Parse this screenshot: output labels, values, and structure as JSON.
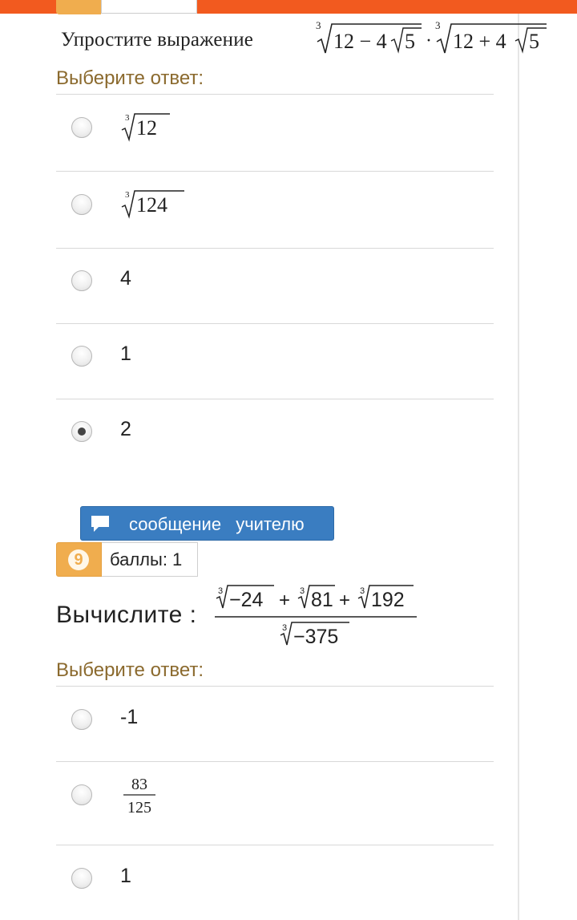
{
  "question1": {
    "text": "Упростите выражение",
    "expr_parts": {
      "root_index": "3",
      "a": "12 − 4",
      "b": "5",
      "dot": "·",
      "c": "12 + 4",
      "d": "5"
    }
  },
  "prompt1": "Выберите ответ:",
  "options1": [
    {
      "root_index": "3",
      "radicand": "12",
      "checked": false
    },
    {
      "root_index": "3",
      "radicand": "124",
      "checked": false
    },
    {
      "label": "4",
      "checked": false
    },
    {
      "label": "1",
      "checked": false
    },
    {
      "label": "2",
      "checked": true
    }
  ],
  "message_button": {
    "label": "сообщение учителю",
    "icon": "speech-bubble-icon"
  },
  "question2_badge": {
    "number": "9",
    "points": "баллы: 1"
  },
  "question2": {
    "text": "Вычислите :",
    "numerator": {
      "r1": "−24",
      "plus1": "+",
      "r2": "81",
      "plus2": "+",
      "r3": "192",
      "index": "3"
    },
    "denominator": {
      "r": "−375",
      "index": "3"
    }
  },
  "prompt2": "Выберите ответ:",
  "options2": [
    {
      "label": "-1",
      "checked": false
    },
    {
      "numerator": "83",
      "denominator": "125",
      "checked": false
    },
    {
      "label": "1",
      "checked": false
    }
  ],
  "colors": {
    "topbar": "#f25a1f",
    "prompt": "#8b6a2e",
    "button": "#3a7dc1",
    "badge": "#f0ad4e"
  }
}
